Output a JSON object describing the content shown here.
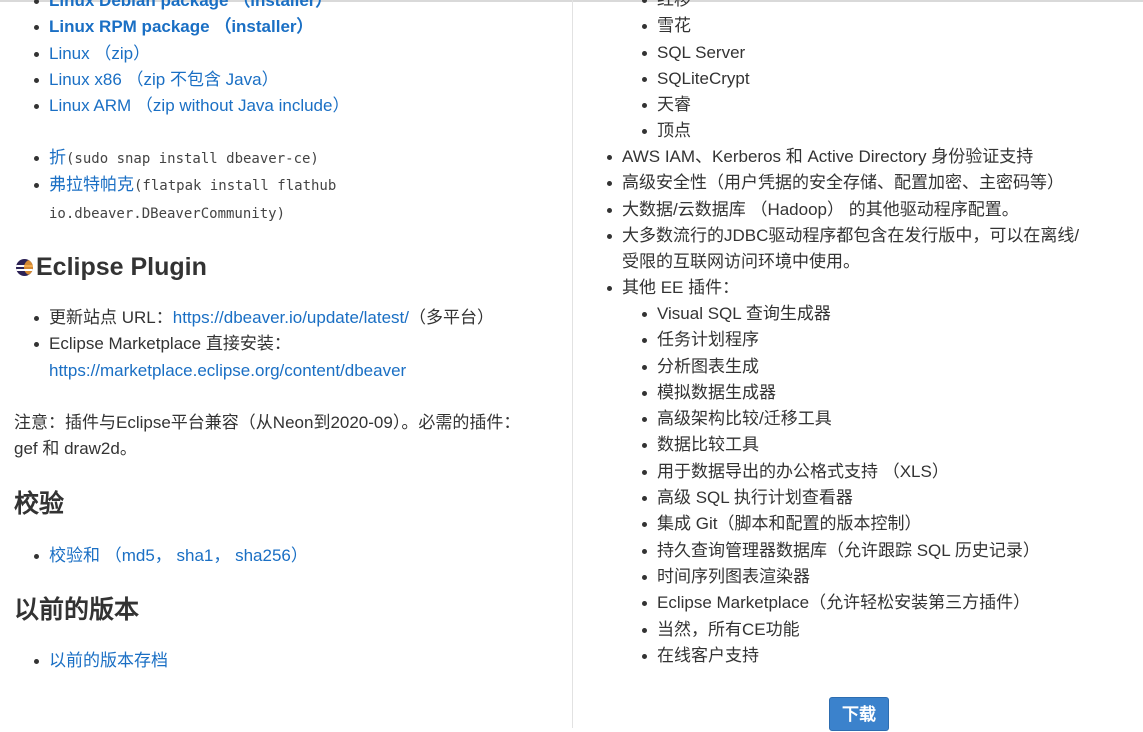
{
  "left": {
    "top_links": [
      {
        "text": "Linux Debian package （installer）",
        "bold": true
      },
      {
        "text": "Linux RPM package （installer）",
        "bold": true
      },
      {
        "text": "Linux （zip）",
        "bold": false
      },
      {
        "text": "Linux x86 （zip 不包含 Java）",
        "bold": false
      },
      {
        "text": "Linux ARM （zip without Java include）",
        "bold": false
      }
    ],
    "snap": {
      "link": "折",
      "cmd": "(sudo snap install dbeaver-ce)"
    },
    "flatpak": {
      "link": "弗拉特帕克",
      "cmd_line1": "(flatpak install flathub",
      "cmd_line2": "io.dbeaver.DBeaverCommunity)"
    },
    "eclipse_title": "Eclipse Plugin",
    "eclipse_items": {
      "update_label": "更新站点 URL：",
      "update_url": "https://dbeaver.io/update/latest/",
      "update_suffix": "（多平台）",
      "market_label": "Eclipse Marketplace 直接安装：",
      "market_url": "https://marketplace.eclipse.org/content/dbeaver"
    },
    "note_line1": "注意：插件与Eclipse平台兼容（从Neon到2020-09）。必需的插件：",
    "note_line2": "gef 和 draw2d。",
    "checksum_title": "校验",
    "checksum_link": "校验和 （md5， sha1， sha256）",
    "prev_title": "以前的版本",
    "prev_link": "以前的版本存档"
  },
  "right": {
    "db_list": [
      "红移",
      "雪花",
      "SQL Server",
      "SQLiteCrypt",
      "天睿",
      "顶点"
    ],
    "features": [
      "AWS IAM、Kerberos 和 Active Directory 身份验证支持",
      "高级安全性（用户凭据的安全存储、配置加密、主密码等）",
      "大数据/云数据库 （Hadoop） 的其他驱动程序配置。",
      "大多数流行的JDBC驱动程序都包含在发行版中，可以在离线/",
      "受限的互联网访问环境中使用。",
      "其他 EE 插件："
    ],
    "plugins": [
      "Visual SQL 查询生成器",
      "任务计划程序",
      "分析图表生成",
      "模拟数据生成器",
      "高级架构比较/迁移工具",
      "数据比较工具",
      "用于数据导出的办公格式支持 （XLS）",
      "高级 SQL 执行计划查看器",
      "集成 Git（脚本和配置的版本控制）",
      "持久查询管理器数据库（允许跟踪 SQL 历史记录）",
      "时间序列图表渲染器",
      "Eclipse Marketplace（允许轻松安装第三方插件）",
      "当然，所有CE功能",
      "在线客户支持"
    ],
    "download_label": "下载"
  }
}
